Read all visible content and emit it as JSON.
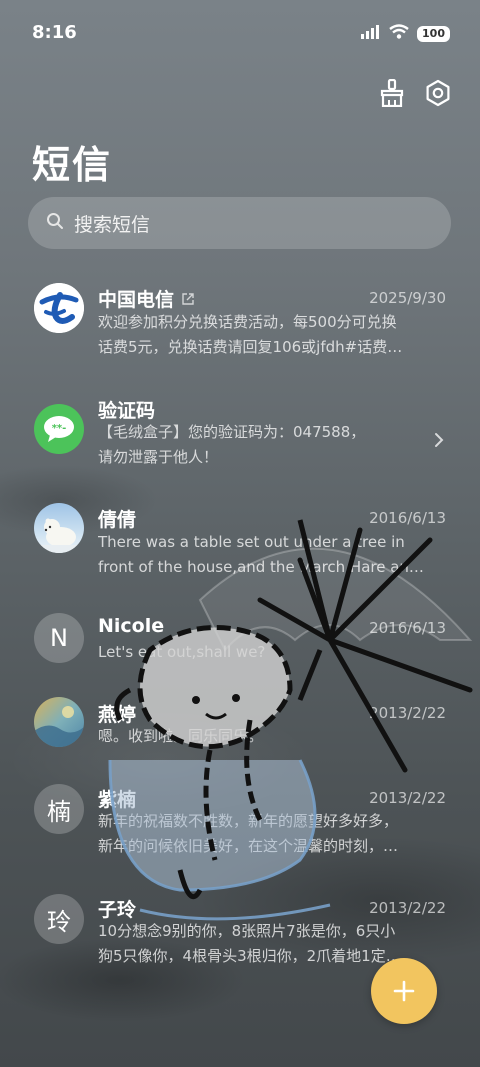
{
  "status": {
    "time": "8:16",
    "battery": "100"
  },
  "page": {
    "title": "短信"
  },
  "search": {
    "placeholder": "搜索短信"
  },
  "conversations": [
    {
      "name": "中国电信",
      "date": "2025/9/30",
      "line1": "欢迎参加积分兑换话费活动，每500分可兑换",
      "line2": "话费5元，兑换话费请回复106或jfdh#话费…"
    },
    {
      "name": "验证码",
      "date": "",
      "line1": "【毛绒盒子】您的验证码为：047588，",
      "line2": "请勿泄露于他人！",
      "avatar_text": "**-"
    },
    {
      "name": "倩倩",
      "date": "2016/6/13",
      "line1": "There was a table set out under a tree in",
      "line2": "front of the house,and the March Hare an…"
    },
    {
      "name": "Nicole",
      "date": "2016/6/13",
      "line1": "Let's eat out,shall we?",
      "line2": "",
      "avatar_text": "N"
    },
    {
      "name": "燕婷",
      "date": "2013/2/22",
      "line1": "嗯。收到啦。同乐同乐。",
      "line2": ""
    },
    {
      "name": "紫楠",
      "date": "2013/2/22",
      "line1": "新年的祝福数不胜数，新年的愿望好多好多，",
      "line2": "新年的问候依旧美好，在这个温馨的时刻，…",
      "avatar_text": "楠"
    },
    {
      "name": "子玲",
      "date": "2013/2/22",
      "line1": "10分想念9别的你，8张照片7张是你，6只小",
      "line2": "狗5只像你，4根骨头3根归你，2爪着地1定…",
      "avatar_text": "玲"
    }
  ],
  "colors": {
    "fab": "#f2c55f",
    "verify_green": "#4cc35a",
    "telecom_blue": "#1f5bb5"
  }
}
